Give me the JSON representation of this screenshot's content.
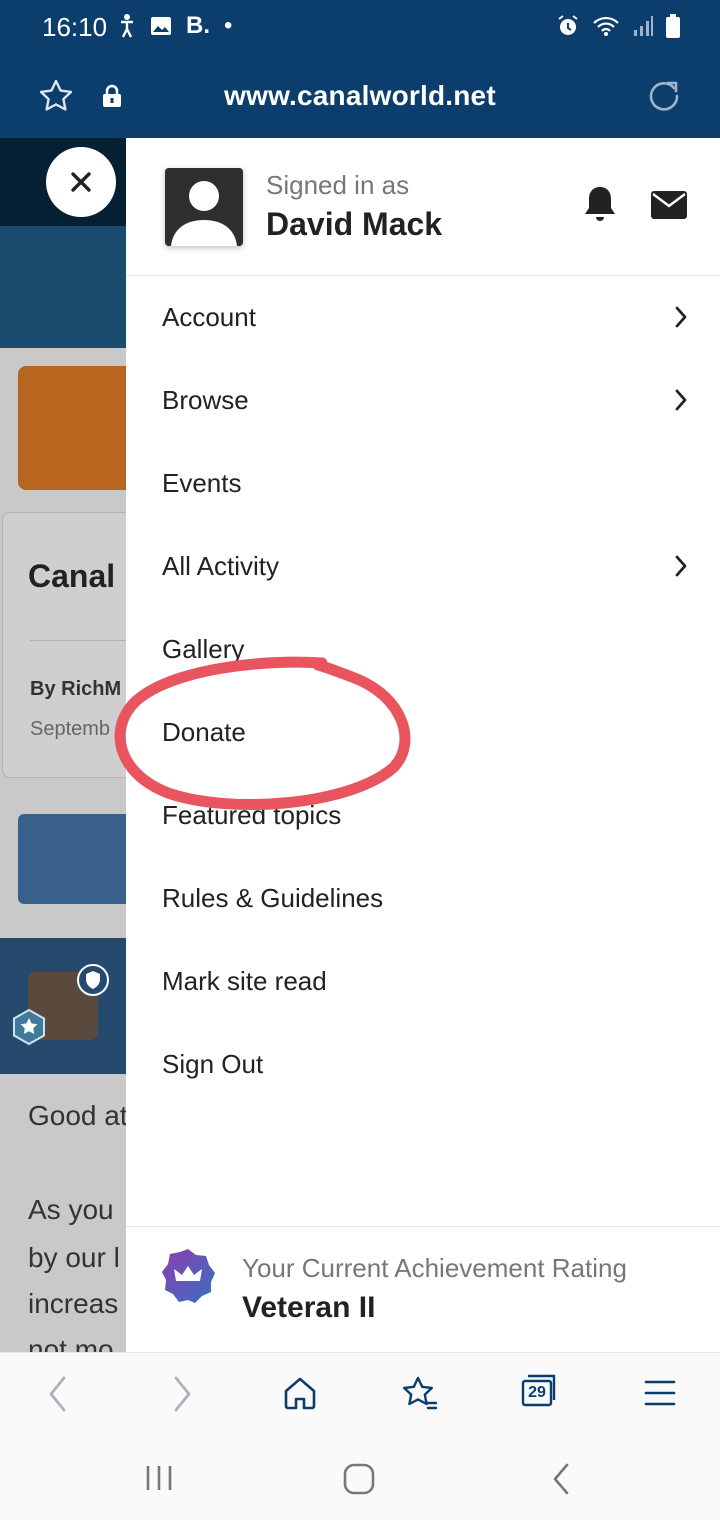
{
  "status_bar": {
    "time": "16:10",
    "brand": "B.",
    "dot": "•"
  },
  "browser": {
    "url": "www.canalworld.net",
    "tab_count": "29"
  },
  "background_page": {
    "card_title": "Canal",
    "card_author": "By RichM",
    "card_date": "Septemb",
    "post_lines": [
      "Good at",
      "As you",
      "by our l",
      "increas",
      "not mo"
    ]
  },
  "drawer": {
    "signed_in_label": "Signed in as",
    "user_name": "David Mack",
    "menu": [
      {
        "label": "Account",
        "has_submenu": true
      },
      {
        "label": "Browse",
        "has_submenu": true
      },
      {
        "label": "Events",
        "has_submenu": false
      },
      {
        "label": "All Activity",
        "has_submenu": true
      },
      {
        "label": "Gallery",
        "has_submenu": false
      },
      {
        "label": "Donate",
        "has_submenu": false
      },
      {
        "label": "Featured topics",
        "has_submenu": false
      },
      {
        "label": "Rules & Guidelines",
        "has_submenu": false
      },
      {
        "label": "Mark site read",
        "has_submenu": false
      },
      {
        "label": "Sign Out",
        "has_submenu": false
      }
    ],
    "achievement": {
      "label": "Your Current Achievement Rating",
      "value": "Veteran II"
    }
  },
  "colors": {
    "header": "#0b3e6c",
    "annotation": "#e8555e",
    "achievement_badge": "#6a4aa0"
  }
}
